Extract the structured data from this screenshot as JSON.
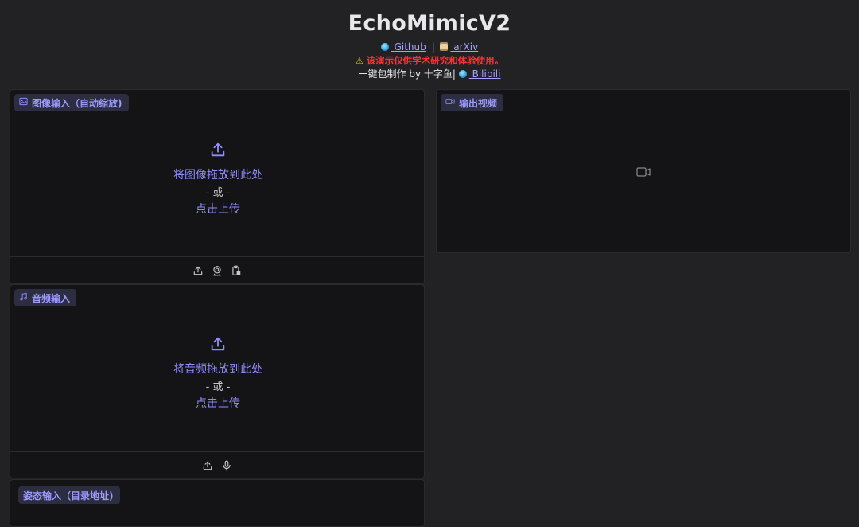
{
  "header": {
    "title": "EchoMimicV2",
    "github_label": " Github",
    "link_separator": "|",
    "arxiv_label": " arXiv",
    "warning_text": "该演示仅供学术研究和体验使用。",
    "credit_text": "一键包制作 by 十字鱼|",
    "bilibili_label": " Bilibili"
  },
  "image_input": {
    "label": "图像输入（自动缩放)",
    "drop_text": "将图像拖放到此处",
    "or_text": "- 或 -",
    "click_text": "点击上传"
  },
  "audio_input": {
    "label": "音频输入",
    "drop_text": "将音频拖放到此处",
    "or_text": "- 或 -",
    "click_text": "点击上传"
  },
  "pose_input": {
    "label": "姿态输入（目录地址)"
  },
  "output_video": {
    "label": "输出视频"
  },
  "colors": {
    "accent": "#9c9aff",
    "warning": "#ff3333",
    "panel_bg": "#141416",
    "page_bg": "#222225"
  },
  "icons": {
    "upload": "upload-icon",
    "webcam": "webcam-icon",
    "clipboard": "clipboard-icon",
    "microphone": "microphone-icon",
    "image": "image-icon",
    "music": "music-icon",
    "video": "video-icon"
  }
}
